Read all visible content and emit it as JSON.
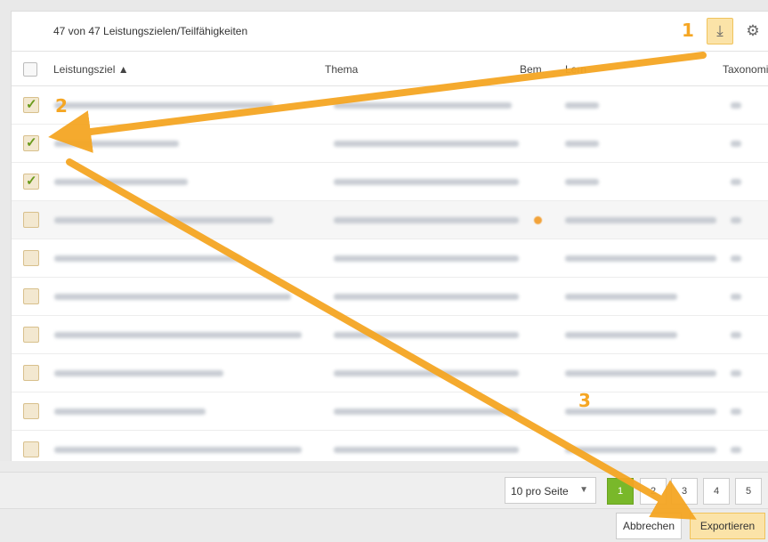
{
  "toolbar": {
    "count_text": "47 von 47 Leistungszielen/Teilfähigkeiten",
    "download_icon": "download-icon",
    "settings_icon": "gear-icon"
  },
  "table": {
    "columns": [
      "Leistungsziel ▲",
      "Thema",
      "Bem.",
      "Lern",
      "Taxonomi"
    ],
    "rows": [
      {
        "checked": true
      },
      {
        "checked": true
      },
      {
        "checked": true
      },
      {
        "checked": false
      },
      {
        "checked": false
      },
      {
        "checked": false
      },
      {
        "checked": false
      },
      {
        "checked": false
      },
      {
        "checked": false
      },
      {
        "checked": false
      }
    ]
  },
  "pagination": {
    "per_page": "10 pro Seite",
    "pages": [
      "1",
      "2",
      "3",
      "4",
      "5"
    ],
    "active_page": "1"
  },
  "buttons": {
    "cancel": "Abbrechen",
    "export": "Exportieren"
  },
  "annotations": {
    "step1": "1",
    "step2": "2",
    "step3": "3",
    "arrow_color": "#f5a623"
  }
}
